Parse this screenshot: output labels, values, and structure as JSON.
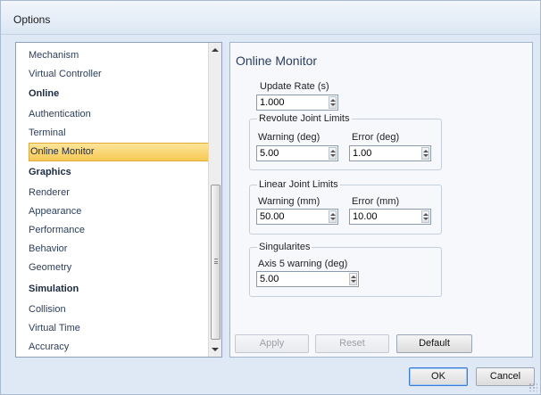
{
  "window": {
    "title": "Options"
  },
  "nav": {
    "items": [
      {
        "label": "Mechanism",
        "type": "item"
      },
      {
        "label": "Virtual Controller",
        "type": "item"
      },
      {
        "label": "Online",
        "type": "header"
      },
      {
        "label": "Authentication",
        "type": "item"
      },
      {
        "label": "Terminal",
        "type": "item"
      },
      {
        "label": "Online Monitor",
        "type": "item",
        "selected": true
      },
      {
        "label": "Graphics",
        "type": "header"
      },
      {
        "label": "Renderer",
        "type": "item"
      },
      {
        "label": "Appearance",
        "type": "item"
      },
      {
        "label": "Performance",
        "type": "item"
      },
      {
        "label": "Behavior",
        "type": "item"
      },
      {
        "label": "Geometry",
        "type": "item"
      },
      {
        "label": "Simulation",
        "type": "header"
      },
      {
        "label": "Collision",
        "type": "item"
      },
      {
        "label": "Virtual Time",
        "type": "item"
      },
      {
        "label": "Accuracy",
        "type": "item"
      }
    ]
  },
  "content": {
    "title": "Online Monitor",
    "update_rate": {
      "label": "Update Rate (s)",
      "value": "1.000"
    },
    "revolute": {
      "title": "Revolute Joint Limits",
      "warning_label": "Warning (deg)",
      "warning_value": "5.00",
      "error_label": "Error (deg)",
      "error_value": "1.00"
    },
    "linear": {
      "title": "Linear Joint Limits",
      "warning_label": "Warning (mm)",
      "warning_value": "50.00",
      "error_label": "Error (mm)",
      "error_value": "10.00"
    },
    "singularities": {
      "title": "Singularites",
      "axis5_label": "Axis 5 warning (deg)",
      "axis5_value": "5.00"
    }
  },
  "buttons": {
    "apply": "Apply",
    "reset": "Reset",
    "default": "Default",
    "ok": "OK",
    "cancel": "Cancel"
  },
  "colors": {
    "selection": "#f6c955",
    "accent": "#3a7bd3"
  }
}
